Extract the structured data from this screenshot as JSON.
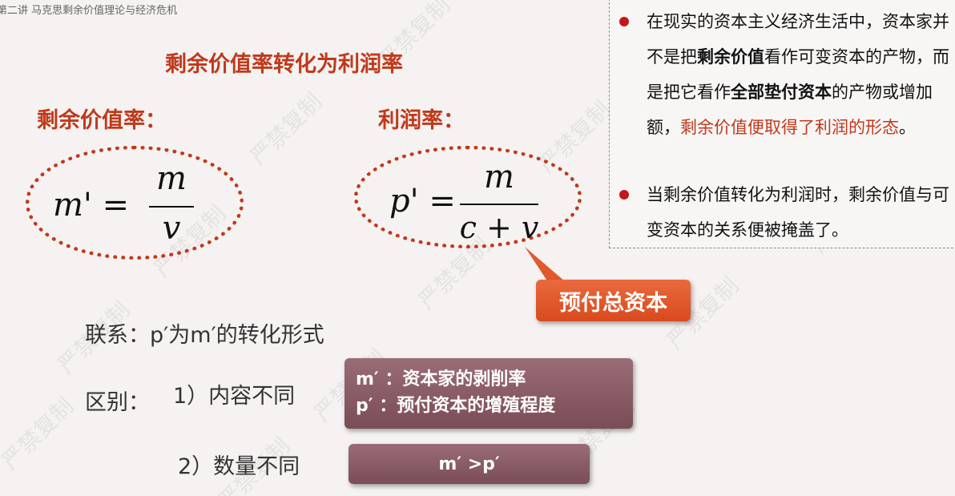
{
  "header": {
    "text": "第二讲  马克思剩余价值理论与经济危机"
  },
  "slide": {
    "title": "剩余价值率转化为利润率",
    "left_label": "剩余价值率：",
    "right_label": "利润率：",
    "formula_left": {
      "lhs": "m' =",
      "numerator": "m",
      "denominator": "v"
    },
    "formula_right": {
      "lhs": "p' =",
      "numerator": "m",
      "denominator": "c + v"
    },
    "callout": "预付总资本"
  },
  "notes": {
    "bullet1": {
      "part1": "在现实的资本主义经济生活中，资本家并不是把",
      "bold1": "剩余价值",
      "part2": "看作可变资本的产物，而是把它看作",
      "bold2": "全部垫付资本",
      "part3": "的产物或增加额，",
      "red": "剩余价值便取得了利润的形态",
      "part4": "。"
    },
    "bullet2": "当剩余价值转化为利润时，剩余价值与可变资本的关系便被掩盖了。"
  },
  "relation": {
    "link_text": "联系：p′为m′的转化形式",
    "diff_label": "区别：",
    "diff1": "1）内容不同",
    "diff2": "2）数量不同",
    "box1_line1": "m′ ：资本家的剥削率",
    "box1_line2": "p′ ：预付资本的增殖程度",
    "box2": "m′ >p′"
  },
  "watermark": "严禁复制",
  "colors": {
    "accent": "#c0391b",
    "bullet": "#c4161c",
    "callout": "#e05a2e",
    "box": "#8a5d66"
  }
}
